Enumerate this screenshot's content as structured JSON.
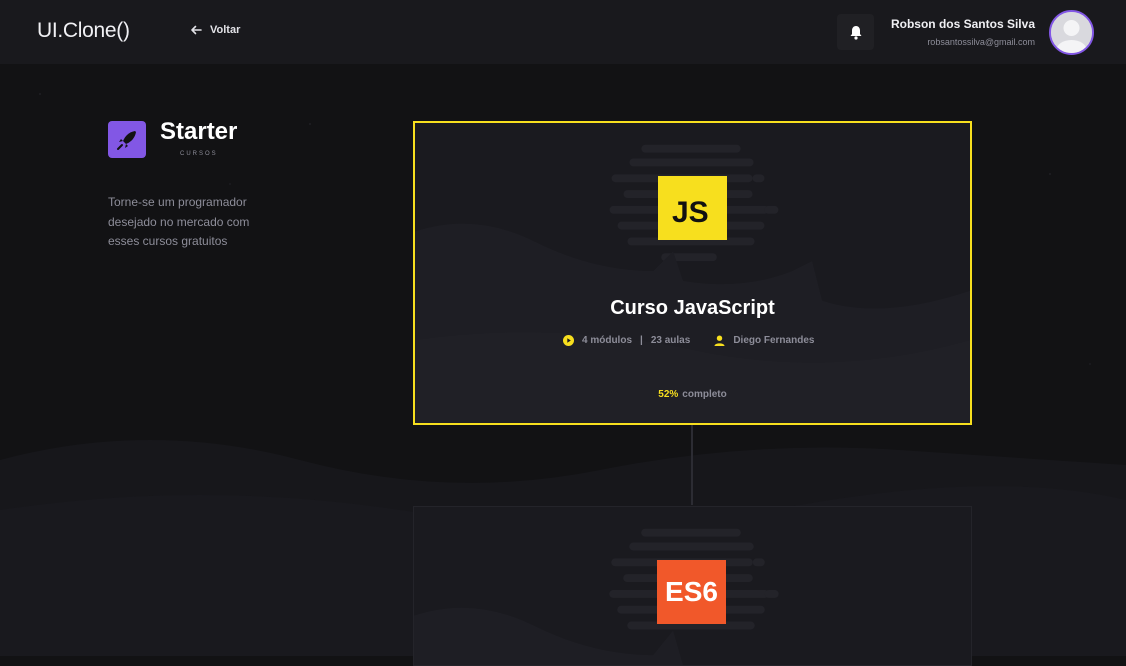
{
  "header": {
    "logo": "UI.Clone()",
    "back_label": "Voltar",
    "user_name": "Robson dos Santos Silva",
    "user_email": "robsantossilva@gmail.com"
  },
  "track": {
    "title": "Starter",
    "subtitle": "CURSOS",
    "description": "Torne-se um programador desejado no mercado com esses cursos gratuitos"
  },
  "courses": [
    {
      "badge": "JS",
      "title": "Curso JavaScript",
      "modules": "4 módulos",
      "lessons": "23 aulas",
      "instructor": "Diego Fernandes",
      "progress_pct": "52%",
      "progress_label": "completo",
      "accent": "#f7df1e"
    },
    {
      "badge": "ES6",
      "accent": "#f1582a"
    }
  ],
  "colors": {
    "brand": "#8257e5",
    "js_yellow": "#f7df1e",
    "es6_orange": "#f1582a",
    "background": "#121214",
    "header": "#19191d"
  }
}
